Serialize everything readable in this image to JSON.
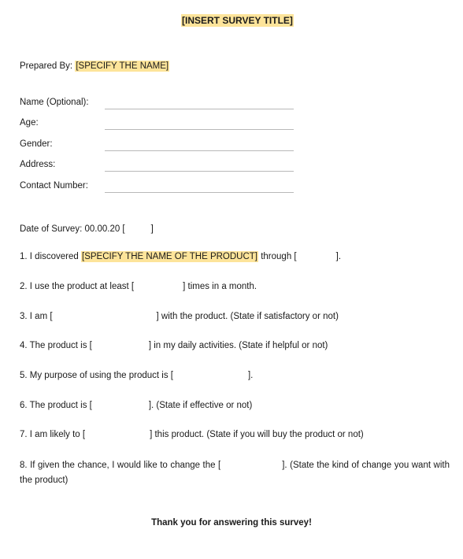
{
  "title": "[INSERT SURVEY TITLE]",
  "prepared_by": {
    "label": "Prepared By:",
    "value": "[SPECIFY THE NAME]"
  },
  "fields": [
    {
      "label": "Name (Optional):"
    },
    {
      "label": "Age:"
    },
    {
      "label": "Gender:"
    },
    {
      "label": "Address:"
    },
    {
      "label": "Contact Number:"
    }
  ],
  "date": {
    "label": "Date of Survey:",
    "value": "00.00.20 [",
    "close": "]"
  },
  "questions": {
    "q1": {
      "pre": "1. I discovered",
      "highlight": "[SPECIFY THE NAME OF THE PRODUCT]",
      "mid": "through [",
      "post": "]."
    },
    "q2": {
      "pre": "2. I use the product at least [",
      "post": "] times in a month."
    },
    "q3": {
      "pre": "3. I am [",
      "post": "] with the product. (State if satisfactory or not)"
    },
    "q4": {
      "pre": "4. The product is [",
      "post": "] in my daily activities. (State if helpful or not)"
    },
    "q5": {
      "pre": "5. My purpose of using the product is [",
      "post": "]."
    },
    "q6": {
      "pre": "6. The product is [",
      "post": "]. (State if effective or not)"
    },
    "q7": {
      "pre": "7. I am likely to [",
      "post": "] this product. (State if you will buy the product or not)"
    },
    "q8": {
      "pre": "8. If given the chance, I would like to change the [",
      "post": "]. (State the kind of change you want with the product)"
    }
  },
  "closing": "Thank you for answering this survey!"
}
